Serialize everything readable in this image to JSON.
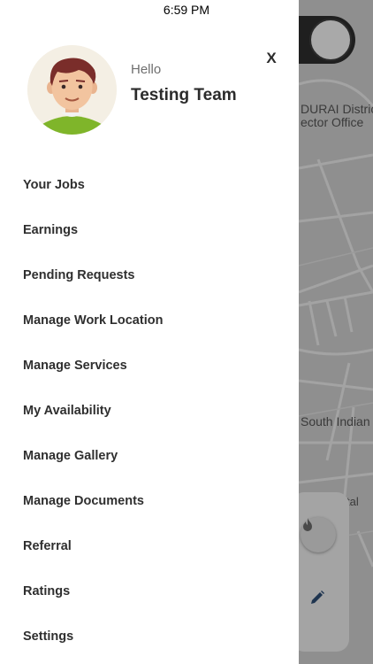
{
  "status_bar": {
    "time": "6:59 PM"
  },
  "header": {
    "greeting": "Hello",
    "user_name": "Testing Team",
    "close_label": "X"
  },
  "menu": {
    "items": [
      {
        "label": "Your Jobs"
      },
      {
        "label": "Earnings"
      },
      {
        "label": "Pending Requests"
      },
      {
        "label": "Manage Work Location"
      },
      {
        "label": "Manage Services"
      },
      {
        "label": "My Availability"
      },
      {
        "label": "Manage Gallery"
      },
      {
        "label": "Manage Documents"
      },
      {
        "label": "Referral"
      },
      {
        "label": "Ratings"
      },
      {
        "label": "Settings"
      }
    ]
  },
  "map": {
    "labels": {
      "district": "DURAI District",
      "collector": "ector Office",
      "south_indian": "South Indian",
      "tal": "tal"
    },
    "fab_icons": [
      "fire-icon",
      "pencil-icon"
    ]
  },
  "colors": {
    "drawer_bg": "#ffffff",
    "overlay": "#8f8f8f",
    "menu_text": "#2f2f2f",
    "greeting_text": "#6f6f6f"
  }
}
